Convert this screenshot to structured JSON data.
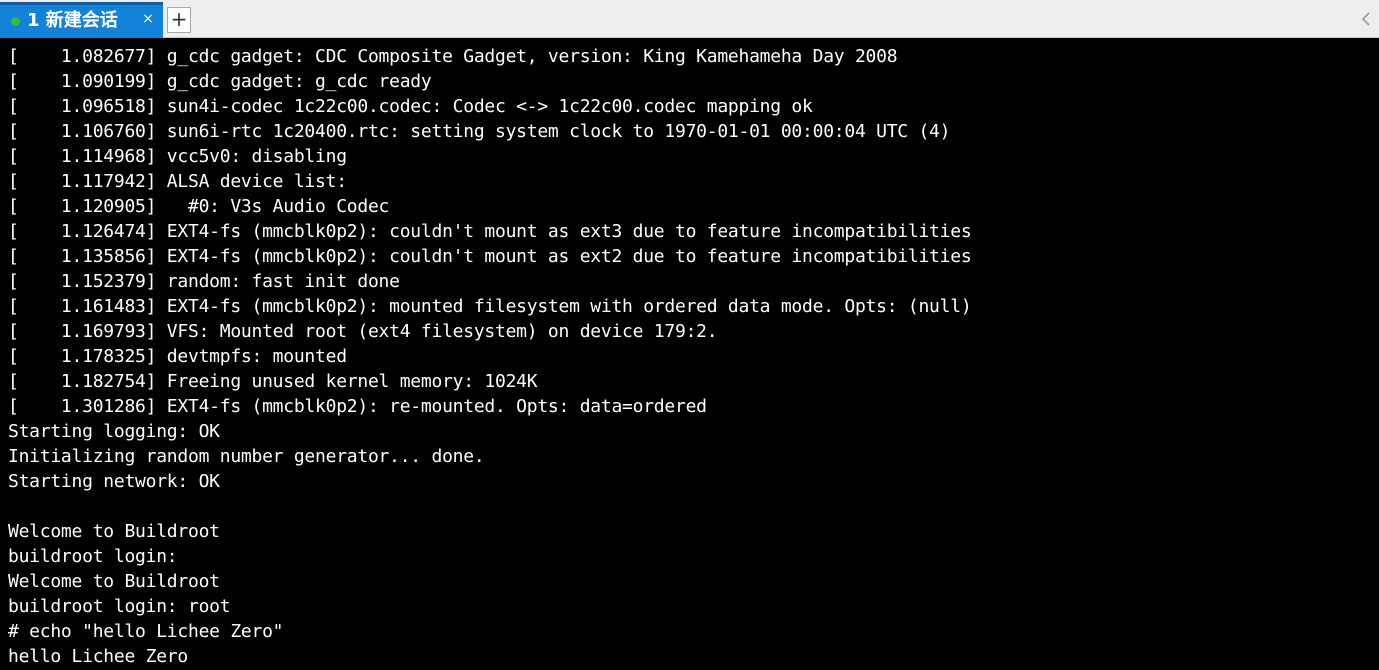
{
  "tabbar": {
    "tab": {
      "title": "1 新建会话",
      "status": "connected",
      "status_color": "#2ec02e",
      "close_glyph": "×"
    },
    "add_tab_glyph": "+"
  },
  "terminal": {
    "lines": [
      "[    1.082677] g_cdc gadget: CDC Composite Gadget, version: King Kamehameha Day 2008",
      "[    1.090199] g_cdc gadget: g_cdc ready",
      "[    1.096518] sun4i-codec 1c22c00.codec: Codec <-> 1c22c00.codec mapping ok",
      "[    1.106760] sun6i-rtc 1c20400.rtc: setting system clock to 1970-01-01 00:00:04 UTC (4)",
      "[    1.114968] vcc5v0: disabling",
      "[    1.117942] ALSA device list:",
      "[    1.120905]   #0: V3s Audio Codec",
      "[    1.126474] EXT4-fs (mmcblk0p2): couldn't mount as ext3 due to feature incompatibilities",
      "[    1.135856] EXT4-fs (mmcblk0p2): couldn't mount as ext2 due to feature incompatibilities",
      "[    1.152379] random: fast init done",
      "[    1.161483] EXT4-fs (mmcblk0p2): mounted filesystem with ordered data mode. Opts: (null)",
      "[    1.169793] VFS: Mounted root (ext4 filesystem) on device 179:2.",
      "[    1.178325] devtmpfs: mounted",
      "[    1.182754] Freeing unused kernel memory: 1024K",
      "[    1.301286] EXT4-fs (mmcblk0p2): re-mounted. Opts: data=ordered",
      "Starting logging: OK",
      "Initializing random number generator... done.",
      "Starting network: OK",
      "",
      "Welcome to Buildroot",
      "buildroot login:",
      "Welcome to Buildroot",
      "buildroot login: root",
      "# echo \"hello Lichee Zero\"",
      "hello Lichee Zero"
    ]
  }
}
